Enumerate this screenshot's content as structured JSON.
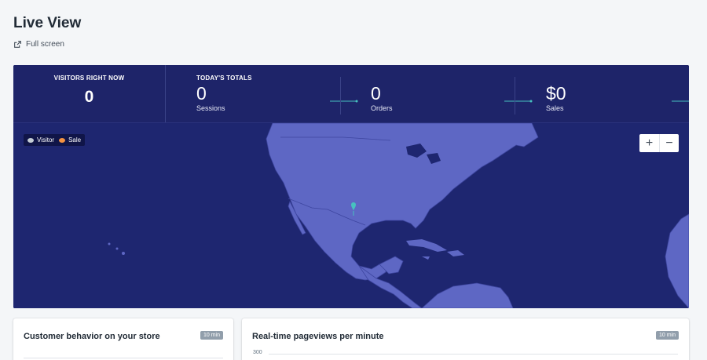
{
  "header": {
    "title": "Live View",
    "full_screen_label": "Full screen"
  },
  "stats": {
    "visitors_label": "VISITORS RIGHT NOW",
    "visitors_value": "0",
    "totals_label": "TODAY'S TOTALS",
    "metrics": [
      {
        "value": "0",
        "label": "Sessions"
      },
      {
        "value": "0",
        "label": "Orders"
      },
      {
        "value": "$0",
        "label": "Sales"
      }
    ]
  },
  "map": {
    "legend": {
      "visitor": "Visitor",
      "sale": "Sale"
    },
    "zoom_in": "+",
    "zoom_out": "−"
  },
  "cards": {
    "behavior": {
      "title": "Customer behavior on your store",
      "badge": "10 min"
    },
    "pageviews": {
      "title": "Real-time pageviews per minute",
      "badge": "10 min",
      "y_tick": "300"
    }
  },
  "colors": {
    "map_water": "#1e2670",
    "map_land": "#5e67c4",
    "accent_spark": "#47c1bf",
    "visitor_dot": "#5e6ac4",
    "sale_dot": "#f49342"
  }
}
